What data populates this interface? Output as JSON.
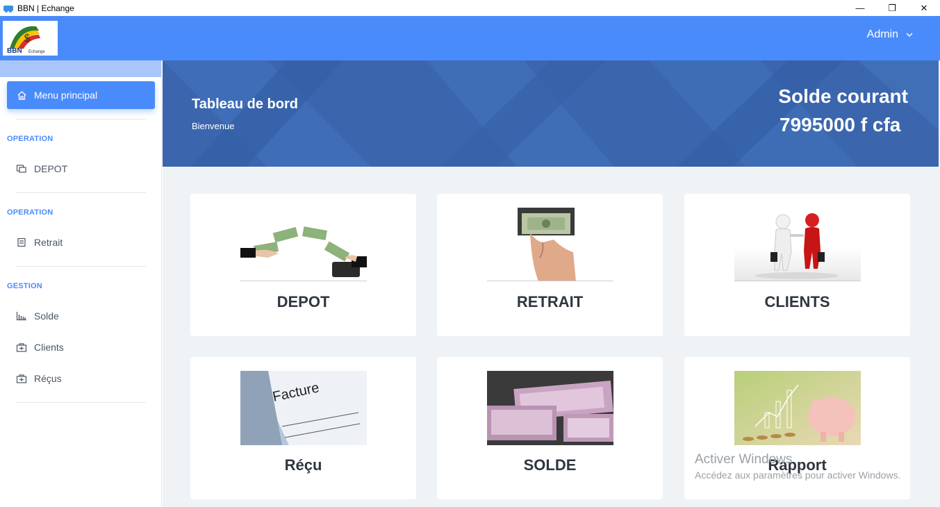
{
  "window": {
    "title": "BBN | Echange",
    "controls": {
      "minimize": "—",
      "restore": "❐",
      "close": "✕"
    }
  },
  "header": {
    "logo_text": "BBN",
    "logo_subtext": "Echange",
    "user_label": "Admin"
  },
  "sidebar": {
    "menu_main": "Menu principal",
    "sections": [
      {
        "label": "OPERATION",
        "items": [
          {
            "label": "DEPOT",
            "icon": "deposit-icon"
          }
        ]
      },
      {
        "label": "OPERATION",
        "items": [
          {
            "label": "Retrait",
            "icon": "withdraw-icon"
          }
        ]
      },
      {
        "label": "GESTION",
        "items": [
          {
            "label": "Solde",
            "icon": "chart-icon"
          },
          {
            "label": "Clients",
            "icon": "clients-icon"
          },
          {
            "label": "Réçus",
            "icon": "receipt-icon"
          }
        ]
      }
    ]
  },
  "banner": {
    "title": "Tableau de bord",
    "subtitle": "Bienvenue",
    "balance_label": "Solde courant",
    "balance_value": "7995000 f cfa"
  },
  "cards": [
    {
      "label": "DEPOT",
      "image": "money-transfer-image"
    },
    {
      "label": "RETRAIT",
      "image": "atm-cash-image"
    },
    {
      "label": "CLIENTS",
      "image": "handshake-image"
    },
    {
      "label": "Réçu",
      "image": "invoice-image",
      "image_text": "Facture"
    },
    {
      "label": "SOLDE",
      "image": "banknotes-image"
    },
    {
      "label": "Rapport",
      "image": "piggy-bank-image"
    }
  ],
  "watermark": {
    "line1": "Activer Windows",
    "line2": "Accédez aux paramètres pour activer Windows."
  },
  "colors": {
    "primary": "#4a8bfb",
    "banner": "#3b66ad",
    "content_bg": "#eff3f6",
    "sidebar_strip": "#a9c6fb"
  }
}
